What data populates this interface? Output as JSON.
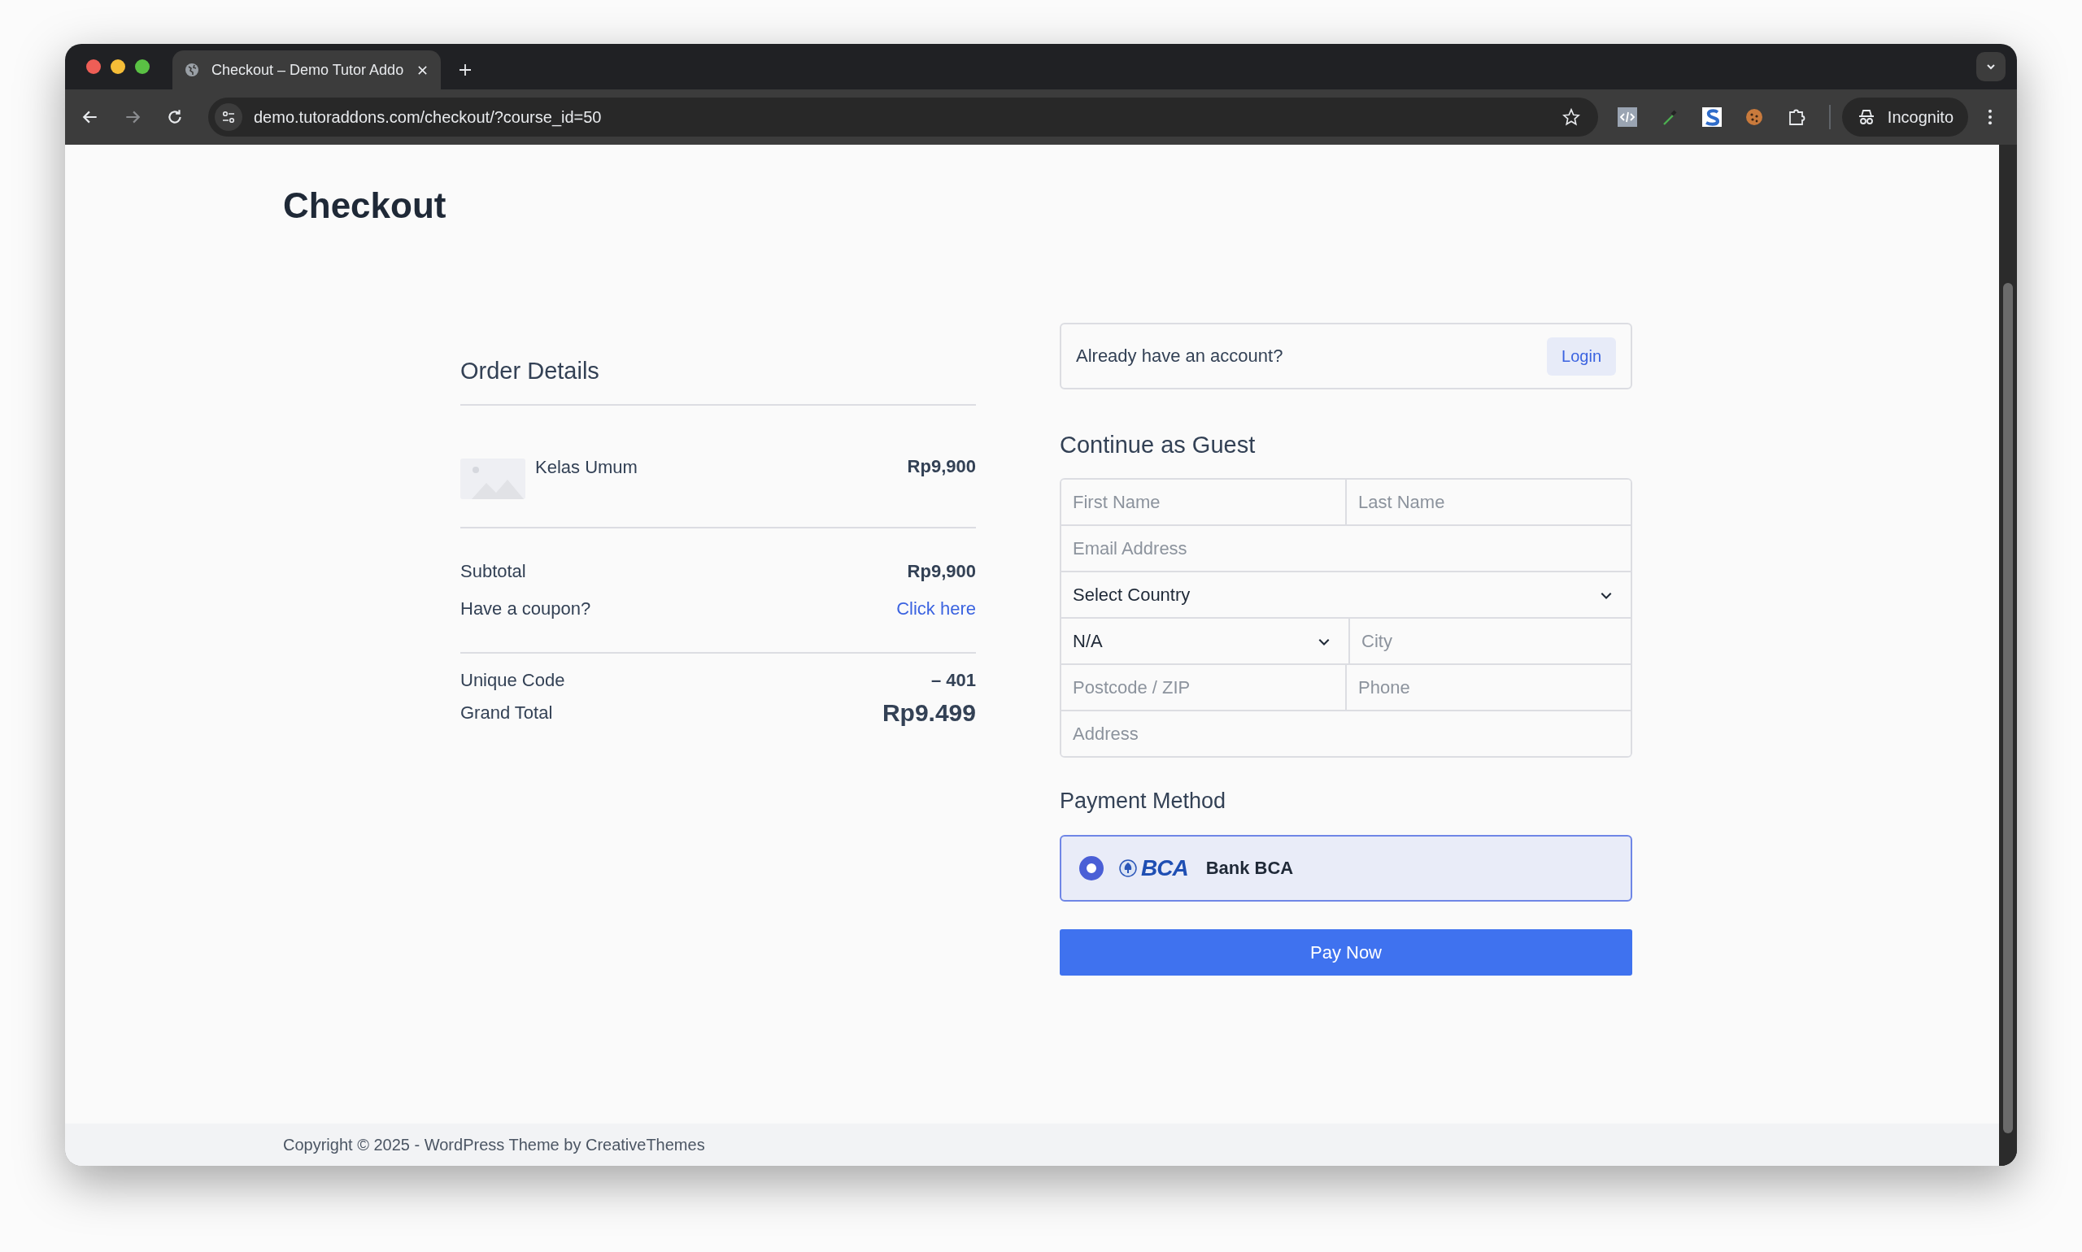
{
  "browser": {
    "tabs": [
      {
        "title": "Checkout – Demo Tutor Addo",
        "selected": true
      }
    ],
    "url": "demo.tutoraddons.com/checkout/?course_id=50",
    "profile": "Incognito"
  },
  "page": {
    "title": "Checkout"
  },
  "order": {
    "heading": "Order Details",
    "items": [
      {
        "name": "Kelas Umum",
        "price": "Rp9,900"
      }
    ],
    "subtotal": {
      "label": "Subtotal",
      "value": "Rp9,900"
    },
    "coupon": {
      "label": "Have a coupon?",
      "link": "Click here"
    },
    "unique_code": {
      "label": "Unique Code",
      "value": "– 401"
    },
    "grand_total": {
      "label": "Grand Total",
      "value": "Rp9.499"
    }
  },
  "account": {
    "text": "Already have an account?",
    "button": "Login"
  },
  "guest": {
    "heading": "Continue as Guest",
    "rows": [
      [
        {
          "kind": "input",
          "placeholder": "First Name"
        },
        {
          "kind": "input",
          "placeholder": "Last Name"
        }
      ],
      [
        {
          "kind": "input",
          "placeholder": "Email Address"
        }
      ],
      [
        {
          "kind": "select",
          "value": "Select Country"
        }
      ],
      [
        {
          "kind": "select",
          "value": "N/A"
        },
        {
          "kind": "input",
          "placeholder": "City"
        }
      ],
      [
        {
          "kind": "input",
          "placeholder": "Postcode / ZIP"
        },
        {
          "kind": "input",
          "placeholder": "Phone"
        }
      ],
      [
        {
          "kind": "input",
          "placeholder": "Address"
        }
      ]
    ]
  },
  "payment": {
    "heading": "Payment Method",
    "methods": [
      {
        "logo": "BCA",
        "name": "Bank BCA",
        "selected": true
      }
    ]
  },
  "pay_button": "Pay Now",
  "footer": "Copyright © 2025 - WordPress Theme by CreativeThemes"
}
